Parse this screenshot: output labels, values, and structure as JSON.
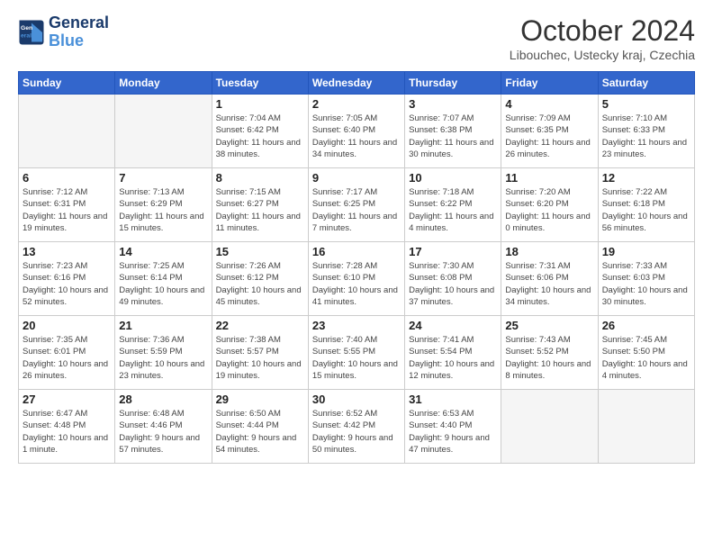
{
  "header": {
    "logo_line1": "General",
    "logo_line2": "Blue",
    "month_title": "October 2024",
    "location": "Libouchec, Ustecky kraj, Czechia"
  },
  "weekdays": [
    "Sunday",
    "Monday",
    "Tuesday",
    "Wednesday",
    "Thursday",
    "Friday",
    "Saturday"
  ],
  "weeks": [
    [
      {
        "day": "",
        "info": ""
      },
      {
        "day": "",
        "info": ""
      },
      {
        "day": "1",
        "info": "Sunrise: 7:04 AM\nSunset: 6:42 PM\nDaylight: 11 hours and 38 minutes."
      },
      {
        "day": "2",
        "info": "Sunrise: 7:05 AM\nSunset: 6:40 PM\nDaylight: 11 hours and 34 minutes."
      },
      {
        "day": "3",
        "info": "Sunrise: 7:07 AM\nSunset: 6:38 PM\nDaylight: 11 hours and 30 minutes."
      },
      {
        "day": "4",
        "info": "Sunrise: 7:09 AM\nSunset: 6:35 PM\nDaylight: 11 hours and 26 minutes."
      },
      {
        "day": "5",
        "info": "Sunrise: 7:10 AM\nSunset: 6:33 PM\nDaylight: 11 hours and 23 minutes."
      }
    ],
    [
      {
        "day": "6",
        "info": "Sunrise: 7:12 AM\nSunset: 6:31 PM\nDaylight: 11 hours and 19 minutes."
      },
      {
        "day": "7",
        "info": "Sunrise: 7:13 AM\nSunset: 6:29 PM\nDaylight: 11 hours and 15 minutes."
      },
      {
        "day": "8",
        "info": "Sunrise: 7:15 AM\nSunset: 6:27 PM\nDaylight: 11 hours and 11 minutes."
      },
      {
        "day": "9",
        "info": "Sunrise: 7:17 AM\nSunset: 6:25 PM\nDaylight: 11 hours and 7 minutes."
      },
      {
        "day": "10",
        "info": "Sunrise: 7:18 AM\nSunset: 6:22 PM\nDaylight: 11 hours and 4 minutes."
      },
      {
        "day": "11",
        "info": "Sunrise: 7:20 AM\nSunset: 6:20 PM\nDaylight: 11 hours and 0 minutes."
      },
      {
        "day": "12",
        "info": "Sunrise: 7:22 AM\nSunset: 6:18 PM\nDaylight: 10 hours and 56 minutes."
      }
    ],
    [
      {
        "day": "13",
        "info": "Sunrise: 7:23 AM\nSunset: 6:16 PM\nDaylight: 10 hours and 52 minutes."
      },
      {
        "day": "14",
        "info": "Sunrise: 7:25 AM\nSunset: 6:14 PM\nDaylight: 10 hours and 49 minutes."
      },
      {
        "day": "15",
        "info": "Sunrise: 7:26 AM\nSunset: 6:12 PM\nDaylight: 10 hours and 45 minutes."
      },
      {
        "day": "16",
        "info": "Sunrise: 7:28 AM\nSunset: 6:10 PM\nDaylight: 10 hours and 41 minutes."
      },
      {
        "day": "17",
        "info": "Sunrise: 7:30 AM\nSunset: 6:08 PM\nDaylight: 10 hours and 37 minutes."
      },
      {
        "day": "18",
        "info": "Sunrise: 7:31 AM\nSunset: 6:06 PM\nDaylight: 10 hours and 34 minutes."
      },
      {
        "day": "19",
        "info": "Sunrise: 7:33 AM\nSunset: 6:03 PM\nDaylight: 10 hours and 30 minutes."
      }
    ],
    [
      {
        "day": "20",
        "info": "Sunrise: 7:35 AM\nSunset: 6:01 PM\nDaylight: 10 hours and 26 minutes."
      },
      {
        "day": "21",
        "info": "Sunrise: 7:36 AM\nSunset: 5:59 PM\nDaylight: 10 hours and 23 minutes."
      },
      {
        "day": "22",
        "info": "Sunrise: 7:38 AM\nSunset: 5:57 PM\nDaylight: 10 hours and 19 minutes."
      },
      {
        "day": "23",
        "info": "Sunrise: 7:40 AM\nSunset: 5:55 PM\nDaylight: 10 hours and 15 minutes."
      },
      {
        "day": "24",
        "info": "Sunrise: 7:41 AM\nSunset: 5:54 PM\nDaylight: 10 hours and 12 minutes."
      },
      {
        "day": "25",
        "info": "Sunrise: 7:43 AM\nSunset: 5:52 PM\nDaylight: 10 hours and 8 minutes."
      },
      {
        "day": "26",
        "info": "Sunrise: 7:45 AM\nSunset: 5:50 PM\nDaylight: 10 hours and 4 minutes."
      }
    ],
    [
      {
        "day": "27",
        "info": "Sunrise: 6:47 AM\nSunset: 4:48 PM\nDaylight: 10 hours and 1 minute."
      },
      {
        "day": "28",
        "info": "Sunrise: 6:48 AM\nSunset: 4:46 PM\nDaylight: 9 hours and 57 minutes."
      },
      {
        "day": "29",
        "info": "Sunrise: 6:50 AM\nSunset: 4:44 PM\nDaylight: 9 hours and 54 minutes."
      },
      {
        "day": "30",
        "info": "Sunrise: 6:52 AM\nSunset: 4:42 PM\nDaylight: 9 hours and 50 minutes."
      },
      {
        "day": "31",
        "info": "Sunrise: 6:53 AM\nSunset: 4:40 PM\nDaylight: 9 hours and 47 minutes."
      },
      {
        "day": "",
        "info": ""
      },
      {
        "day": "",
        "info": ""
      }
    ]
  ]
}
